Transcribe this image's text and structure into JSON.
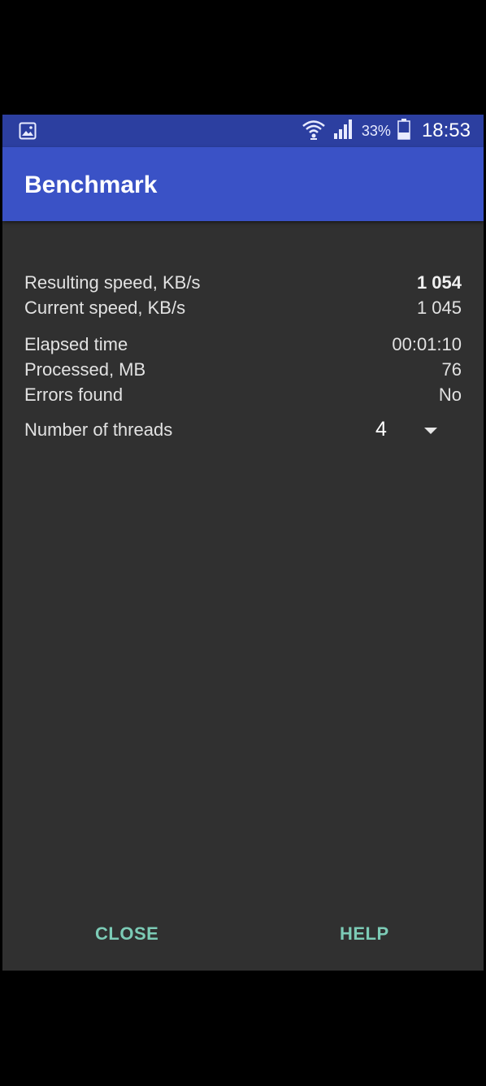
{
  "status_bar": {
    "notification_icon": "image-icon",
    "wifi_icon": "wifi-icon",
    "signal_icon": "signal-icon",
    "battery_percent": "33%",
    "battery_icon": "battery-icon",
    "time": "18:53"
  },
  "app_bar": {
    "title": "Benchmark"
  },
  "stats": {
    "resulting_speed": {
      "label": "Resulting speed, KB/s",
      "value": "1 054"
    },
    "current_speed": {
      "label": "Current speed, KB/s",
      "value": "1 045"
    },
    "elapsed_time": {
      "label": "Elapsed time",
      "value": "00:01:10"
    },
    "processed": {
      "label": "Processed, MB",
      "value": "76"
    },
    "errors": {
      "label": "Errors found",
      "value": "No"
    }
  },
  "threads": {
    "label": "Number of threads",
    "value": "4"
  },
  "buttons": {
    "close": "CLOSE",
    "help": "HELP"
  },
  "colors": {
    "status_bar": "#2c3fa0",
    "app_bar": "#3a52c6",
    "background": "#303030",
    "button_text": "#7ccbb6"
  }
}
